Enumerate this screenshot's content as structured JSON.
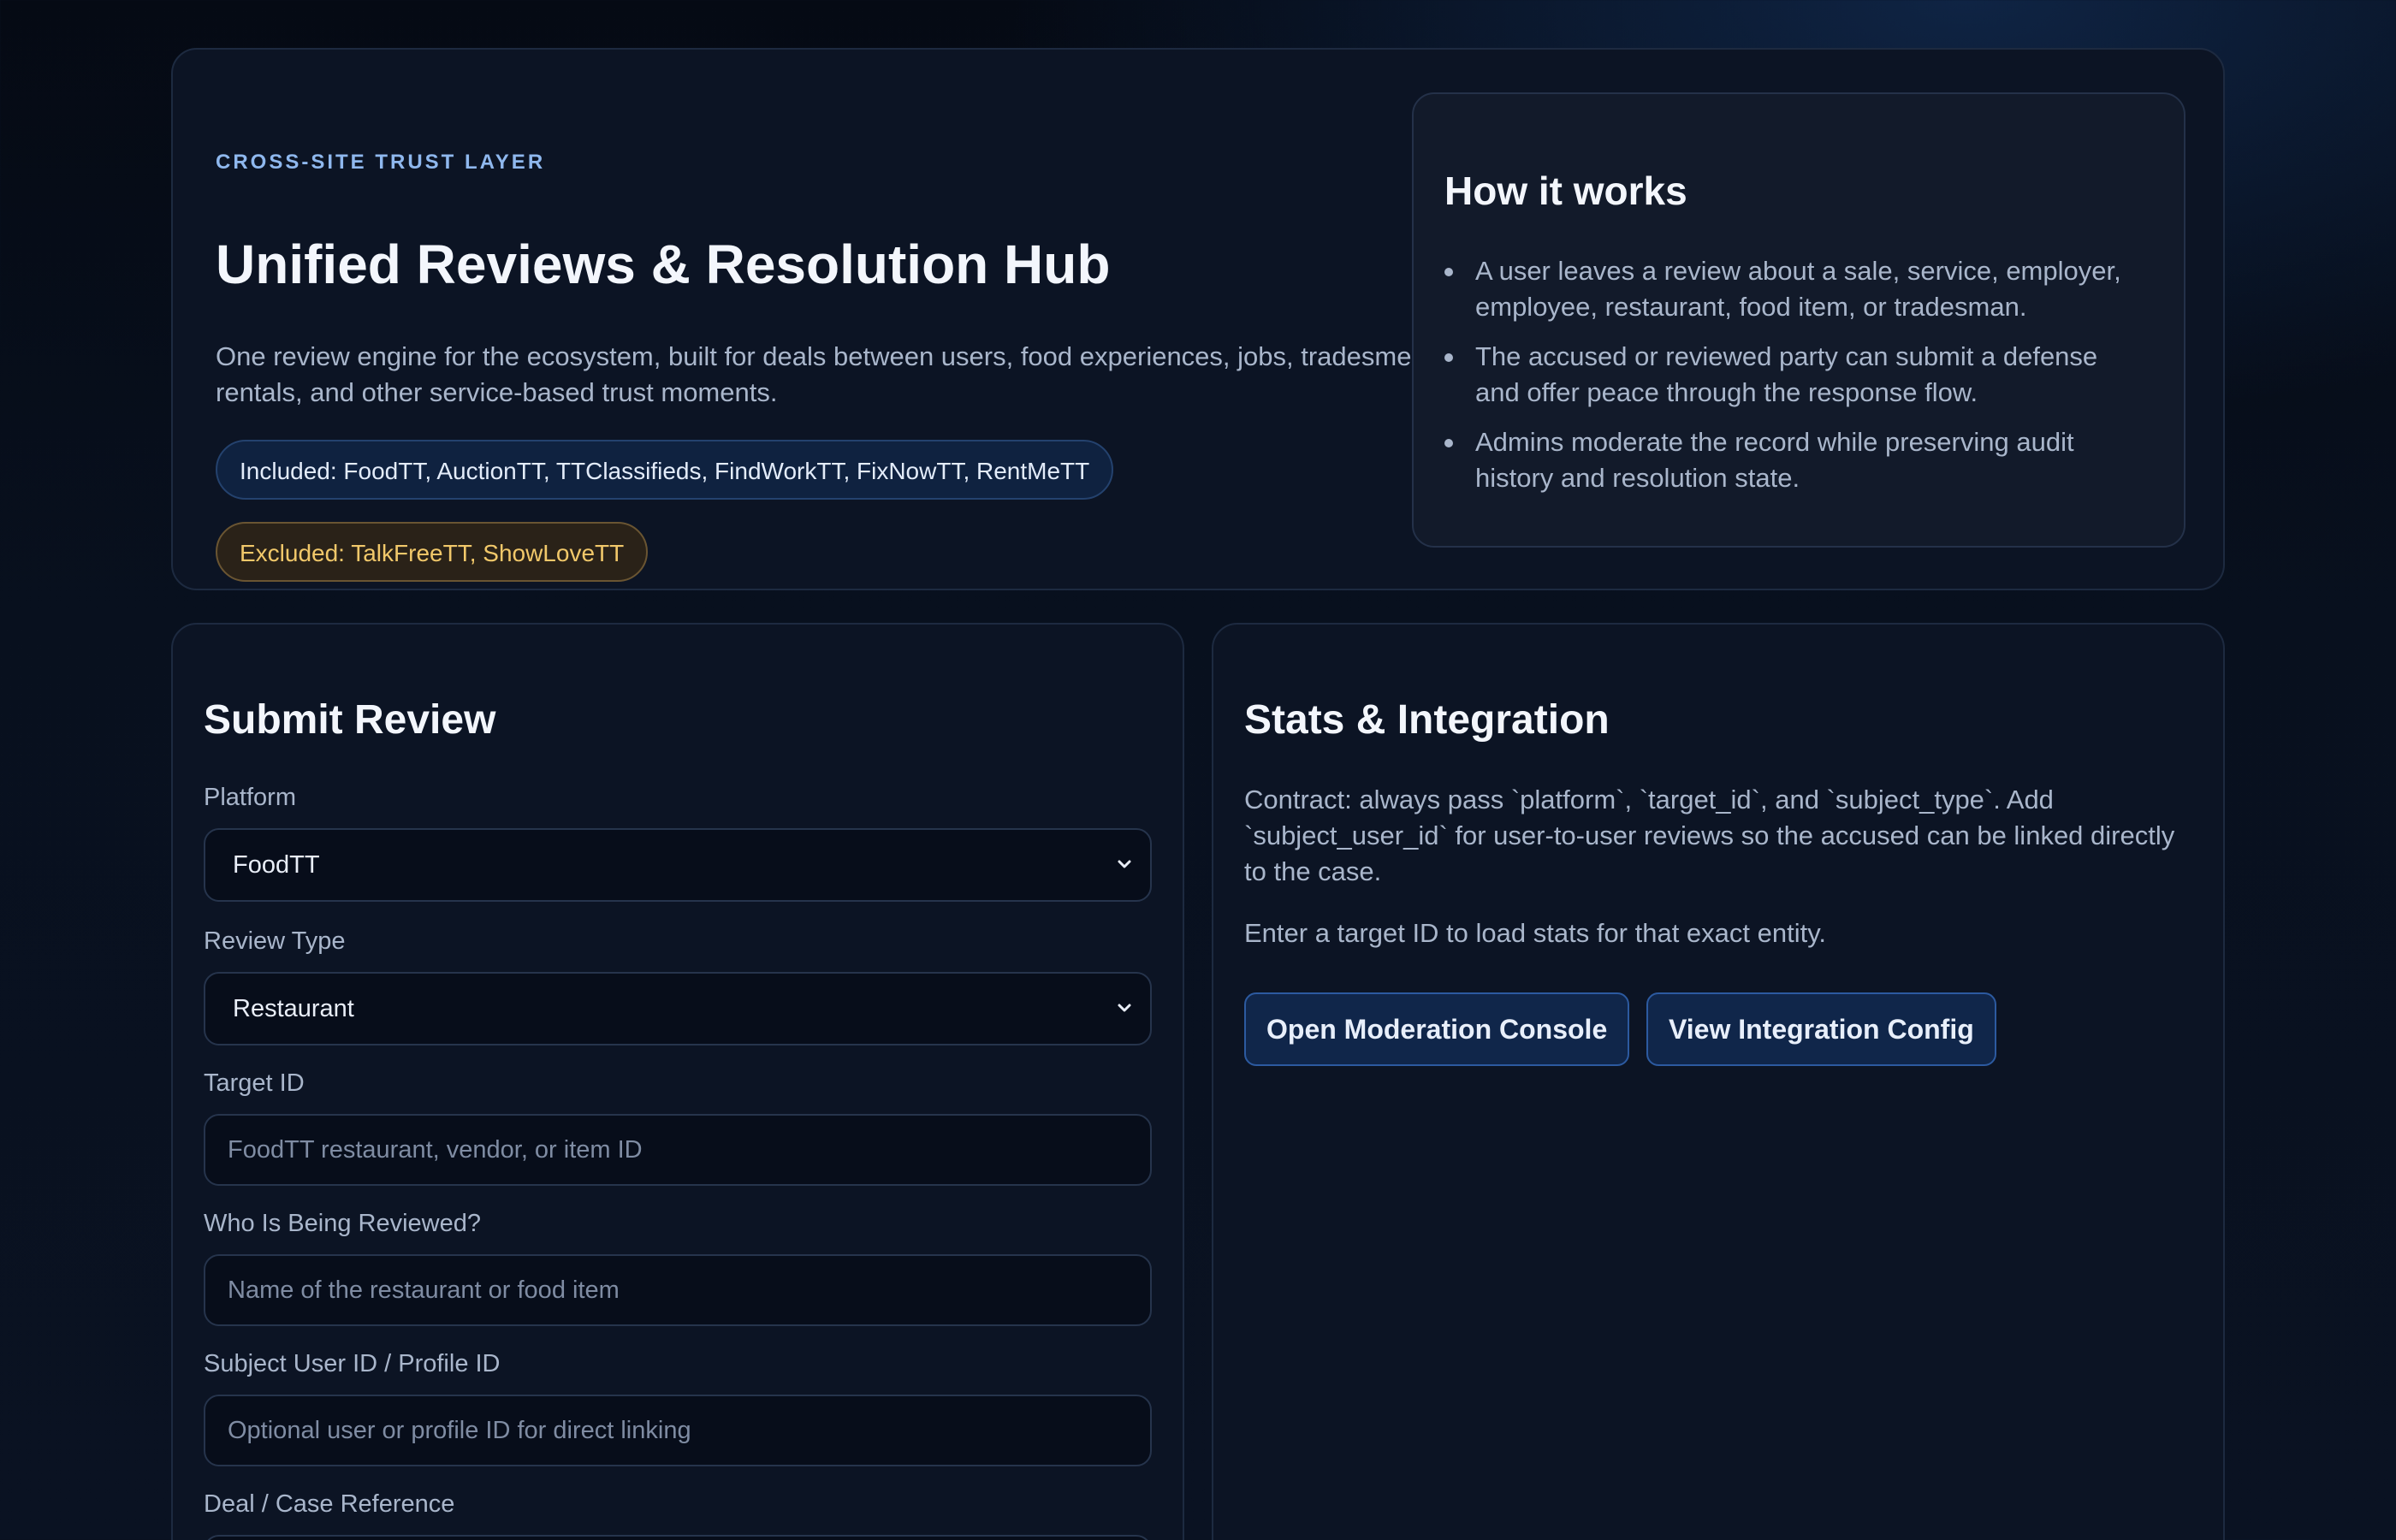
{
  "hero": {
    "eyebrow": "CROSS-SITE TRUST LAYER",
    "title": "Unified Reviews & Resolution Hub",
    "description": "One review engine for the ecosystem, built for deals between users, food experiences, jobs, tradesmen, rentals, and other service-based trust moments.",
    "included": "Included: FoodTT, AuctionTT, TTClassifieds, FindWorkTT, FixNowTT, RentMeTT",
    "excluded": "Excluded: TalkFreeTT, ShowLoveTT"
  },
  "how_it_works": {
    "title": "How it works",
    "steps": [
      "A user leaves a review about a sale, service, employer, employee, restaurant, food item, or tradesman.",
      "The accused or reviewed party can submit a defense and offer peace through the response flow.",
      "Admins moderate the record while preserving audit history and resolution state."
    ]
  },
  "submit_review": {
    "title": "Submit Review",
    "platform": {
      "label": "Platform",
      "value": "FoodTT"
    },
    "review_type": {
      "label": "Review Type",
      "value": "Restaurant"
    },
    "target_id": {
      "label": "Target ID",
      "placeholder": "FoodTT restaurant, vendor, or item ID"
    },
    "who_reviewed": {
      "label": "Who Is Being Reviewed?",
      "placeholder": "Name of the restaurant or food item"
    },
    "subject_user": {
      "label": "Subject User ID / Profile ID",
      "placeholder": "Optional user or profile ID for direct linking"
    },
    "deal_ref": {
      "label": "Deal / Case Reference"
    }
  },
  "stats": {
    "title": "Stats & Integration",
    "contract": "Contract: always pass `platform`, `target_id`, and `subject_type`. Add `subject_user_id` for user-to-user reviews so the accused can be linked directly to the case.",
    "hint": "Enter a target ID to load stats for that exact entity.",
    "moderation_button": "Open Moderation Console",
    "config_button": "View Integration Config"
  },
  "colors": {
    "accent": "#8fb8ee",
    "excluded": "#f1c86a",
    "background": "#08101e"
  }
}
